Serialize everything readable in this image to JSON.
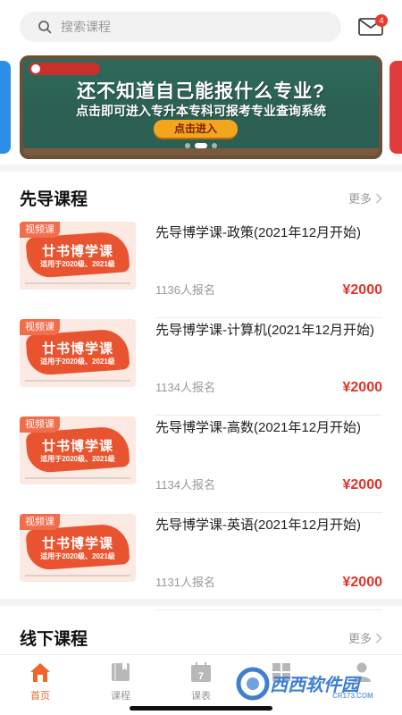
{
  "search": {
    "placeholder": "搜索课程"
  },
  "mail": {
    "badge": "4"
  },
  "banner": {
    "logo_text": "",
    "headline": "还不知道自己能报什么专业?",
    "subline": "点击即可进入专升本专科可报考专业查询系统",
    "cta": "点击进入"
  },
  "sections": {
    "guided": {
      "title": "先导课程",
      "more": "更多"
    },
    "offline": {
      "title": "线下课程",
      "more": "更多"
    }
  },
  "courses": [
    {
      "tag": "视频课",
      "cover_title": "廿书博学课",
      "cover_sub": "适用于2020级、2021级",
      "title": "先导博学课-政策(2021年12月开始)",
      "count": "1136人报名",
      "price": "¥2000"
    },
    {
      "tag": "视频课",
      "cover_title": "廿书博学课",
      "cover_sub": "适用于2020级、2021级",
      "title": "先导博学课-计算机(2021年12月开始)",
      "count": "1134人报名",
      "price": "¥2000"
    },
    {
      "tag": "视频课",
      "cover_title": "廿书博学课",
      "cover_sub": "适用于2020级、2021级",
      "title": "先导博学课-高数(2021年12月开始)",
      "count": "1134人报名",
      "price": "¥2000"
    },
    {
      "tag": "视频课",
      "cover_title": "廿书博学课",
      "cover_sub": "适用于2020级、2021级",
      "title": "先导博学课-英语(2021年12月开始)",
      "count": "1131人报名",
      "price": "¥2000"
    }
  ],
  "tabbar": [
    {
      "label": "首页",
      "icon": "home-icon",
      "active": true
    },
    {
      "label": "课程",
      "icon": "book-icon",
      "active": false
    },
    {
      "label": "课表",
      "icon": "calendar-icon",
      "active": false
    },
    {
      "label": "",
      "icon": "grid-icon",
      "active": false
    },
    {
      "label": "",
      "icon": "user-icon",
      "active": false
    }
  ],
  "watermark": {
    "text": "西西软件园",
    "url": "CR173.COM"
  },
  "colors": {
    "accent": "#f0642e",
    "price": "#e0332a",
    "badge": "#e63b2e",
    "chalkboard": "#2f6a5b"
  }
}
